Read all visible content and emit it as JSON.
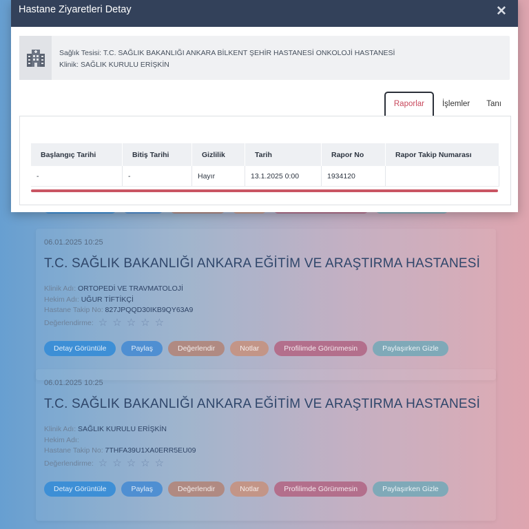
{
  "modal": {
    "title": "Hastane Ziyaretleri Detay",
    "close_icon": "close-icon",
    "facility": {
      "icon": "hospital-building-icon",
      "facility_label": "Sağlık Tesisi:",
      "facility_value": "T.C. SAĞLIK BAKANLIĞI ANKARA BİLKENT ŞEHİR HASTANESİ ONKOLOJİ HASTANESİ",
      "clinic_label": "Klinik:",
      "clinic_value": "SAĞLIK KURULU ERİŞKİN"
    },
    "tabs": [
      {
        "label": "Raporlar",
        "active": true
      },
      {
        "label": "İşlemler",
        "active": false
      },
      {
        "label": "Tanı",
        "active": false
      }
    ],
    "table": {
      "headers": [
        "Başlangıç Tarihi",
        "Bitiş Tarihi",
        "Gizlilik",
        "Tarih",
        "Rapor No",
        "Rapor Takip Numarası"
      ],
      "rows": [
        [
          "-",
          "-",
          "Hayır",
          "13.1.2025 0:00",
          "1934120",
          ""
        ]
      ]
    }
  },
  "visits": [
    {
      "date": "06.01.2025 10:25",
      "title": "T.C. SAĞLIK BAKANLIĞI ANKARA EĞİTİM VE ARAŞTIRMA HASTANESİ",
      "clinic_label": "Klinik Adı:",
      "clinic_value": "ORTOPEDİ VE TRAVMATOLOJİ",
      "doctor_label": "Hekim Adı:",
      "doctor_value": "UĞUR TİFTİKÇİ",
      "tracking_label": "Hastane Takip No:",
      "tracking_value": "827JPQQD30IKB9QY63A9",
      "rating_label": "Değerlendirme:",
      "rating": 0
    },
    {
      "date": "06.01.2025 10:25",
      "title": "T.C. SAĞLIK BAKANLIĞI ANKARA EĞİTİM VE ARAŞTIRMA HASTANESİ",
      "clinic_label": "Klinik Adı:",
      "clinic_value": "SAĞLIK KURULU ERİŞKİN",
      "doctor_label": "Hekim Adı:",
      "doctor_value": "",
      "tracking_label": "Hastane Takip No:",
      "tracking_value": "7THFA39U1XA0ERR5EU09",
      "rating_label": "Değerlendirme:",
      "rating": 0
    }
  ],
  "visit_buttons": [
    "Detay Görüntüle",
    "Paylaş",
    "Değerlendir",
    "Notlar",
    "Profilimde Görünmesin",
    "Paylaşırken Gizle"
  ],
  "colors": {
    "header_bg": "#33415a",
    "active_tab_text": "#c8485c",
    "accent_red": "#c95563"
  }
}
